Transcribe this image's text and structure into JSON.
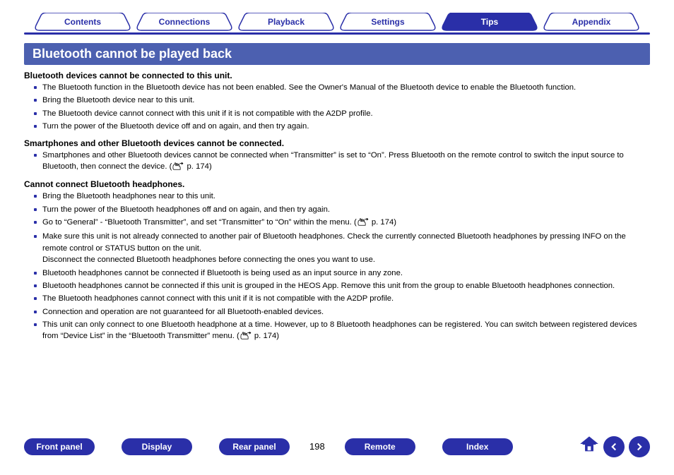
{
  "tabs": [
    {
      "label": "Contents",
      "active": false
    },
    {
      "label": "Connections",
      "active": false
    },
    {
      "label": "Playback",
      "active": false
    },
    {
      "label": "Settings",
      "active": false
    },
    {
      "label": "Tips",
      "active": true
    },
    {
      "label": "Appendix",
      "active": false
    }
  ],
  "section_title": "Bluetooth cannot be played back",
  "groups": [
    {
      "heading": "Bluetooth devices cannot be connected to this unit.",
      "items": [
        {
          "text": "The Bluetooth function in the Bluetooth device has not been enabled. See the Owner's Manual of the Bluetooth device to enable the Bluetooth function."
        },
        {
          "text": "Bring the Bluetooth device near to this unit."
        },
        {
          "text": "The Bluetooth device cannot connect with this unit if it is not compatible with the A2DP profile."
        },
        {
          "text": "Turn the power of the Bluetooth device off and on again, and then try again."
        }
      ]
    },
    {
      "heading": "Smartphones and other Bluetooth devices cannot be connected.",
      "items": [
        {
          "text": "Smartphones and other Bluetooth devices cannot be connected when “Transmitter” is set to “On”. Press Bluetooth on the remote control to switch the input source to Bluetooth, then connect the device.  (",
          "ref": " p. 174)"
        }
      ]
    },
    {
      "heading": "Cannot connect Bluetooth headphones.",
      "items": [
        {
          "text": "Bring the Bluetooth headphones near to this unit."
        },
        {
          "text": "Turn the power of the Bluetooth headphones off and on again, and then try again."
        },
        {
          "text": "Go to “General” - “Bluetooth Transmitter”, and set “Transmitter” to “On” within the menu.  (",
          "ref": " p. 174)"
        },
        {
          "text": "Make sure this unit is not already connected to another pair of Bluetooth headphones. Check the currently connected Bluetooth headphones by pressing INFO on the remote control or STATUS button on the unit.\nDisconnect the connected Bluetooth headphones before connecting the ones you want to use."
        },
        {
          "text": "Bluetooth headphones cannot be connected if Bluetooth is being used as an input source in any zone."
        },
        {
          "text": "Bluetooth headphones cannot be connected if this unit is grouped in the HEOS App. Remove this unit from the group to enable Bluetooth headphones connection."
        },
        {
          "text": "The Bluetooth headphones cannot connect with this unit if it is not compatible with the A2DP profile."
        },
        {
          "text": "Connection and operation are not guaranteed for all Bluetooth-enabled devices."
        },
        {
          "text": "This unit can only connect to one Bluetooth headphone at a time. However, up to 8 Bluetooth headphones can be registered. You can switch between registered devices from “Device List” in the “Bluetooth Transmitter” menu.  (",
          "ref": " p. 174)"
        }
      ]
    }
  ],
  "bottom_links": [
    "Front panel",
    "Display",
    "Rear panel",
    "Remote",
    "Index"
  ],
  "page_number": "198"
}
